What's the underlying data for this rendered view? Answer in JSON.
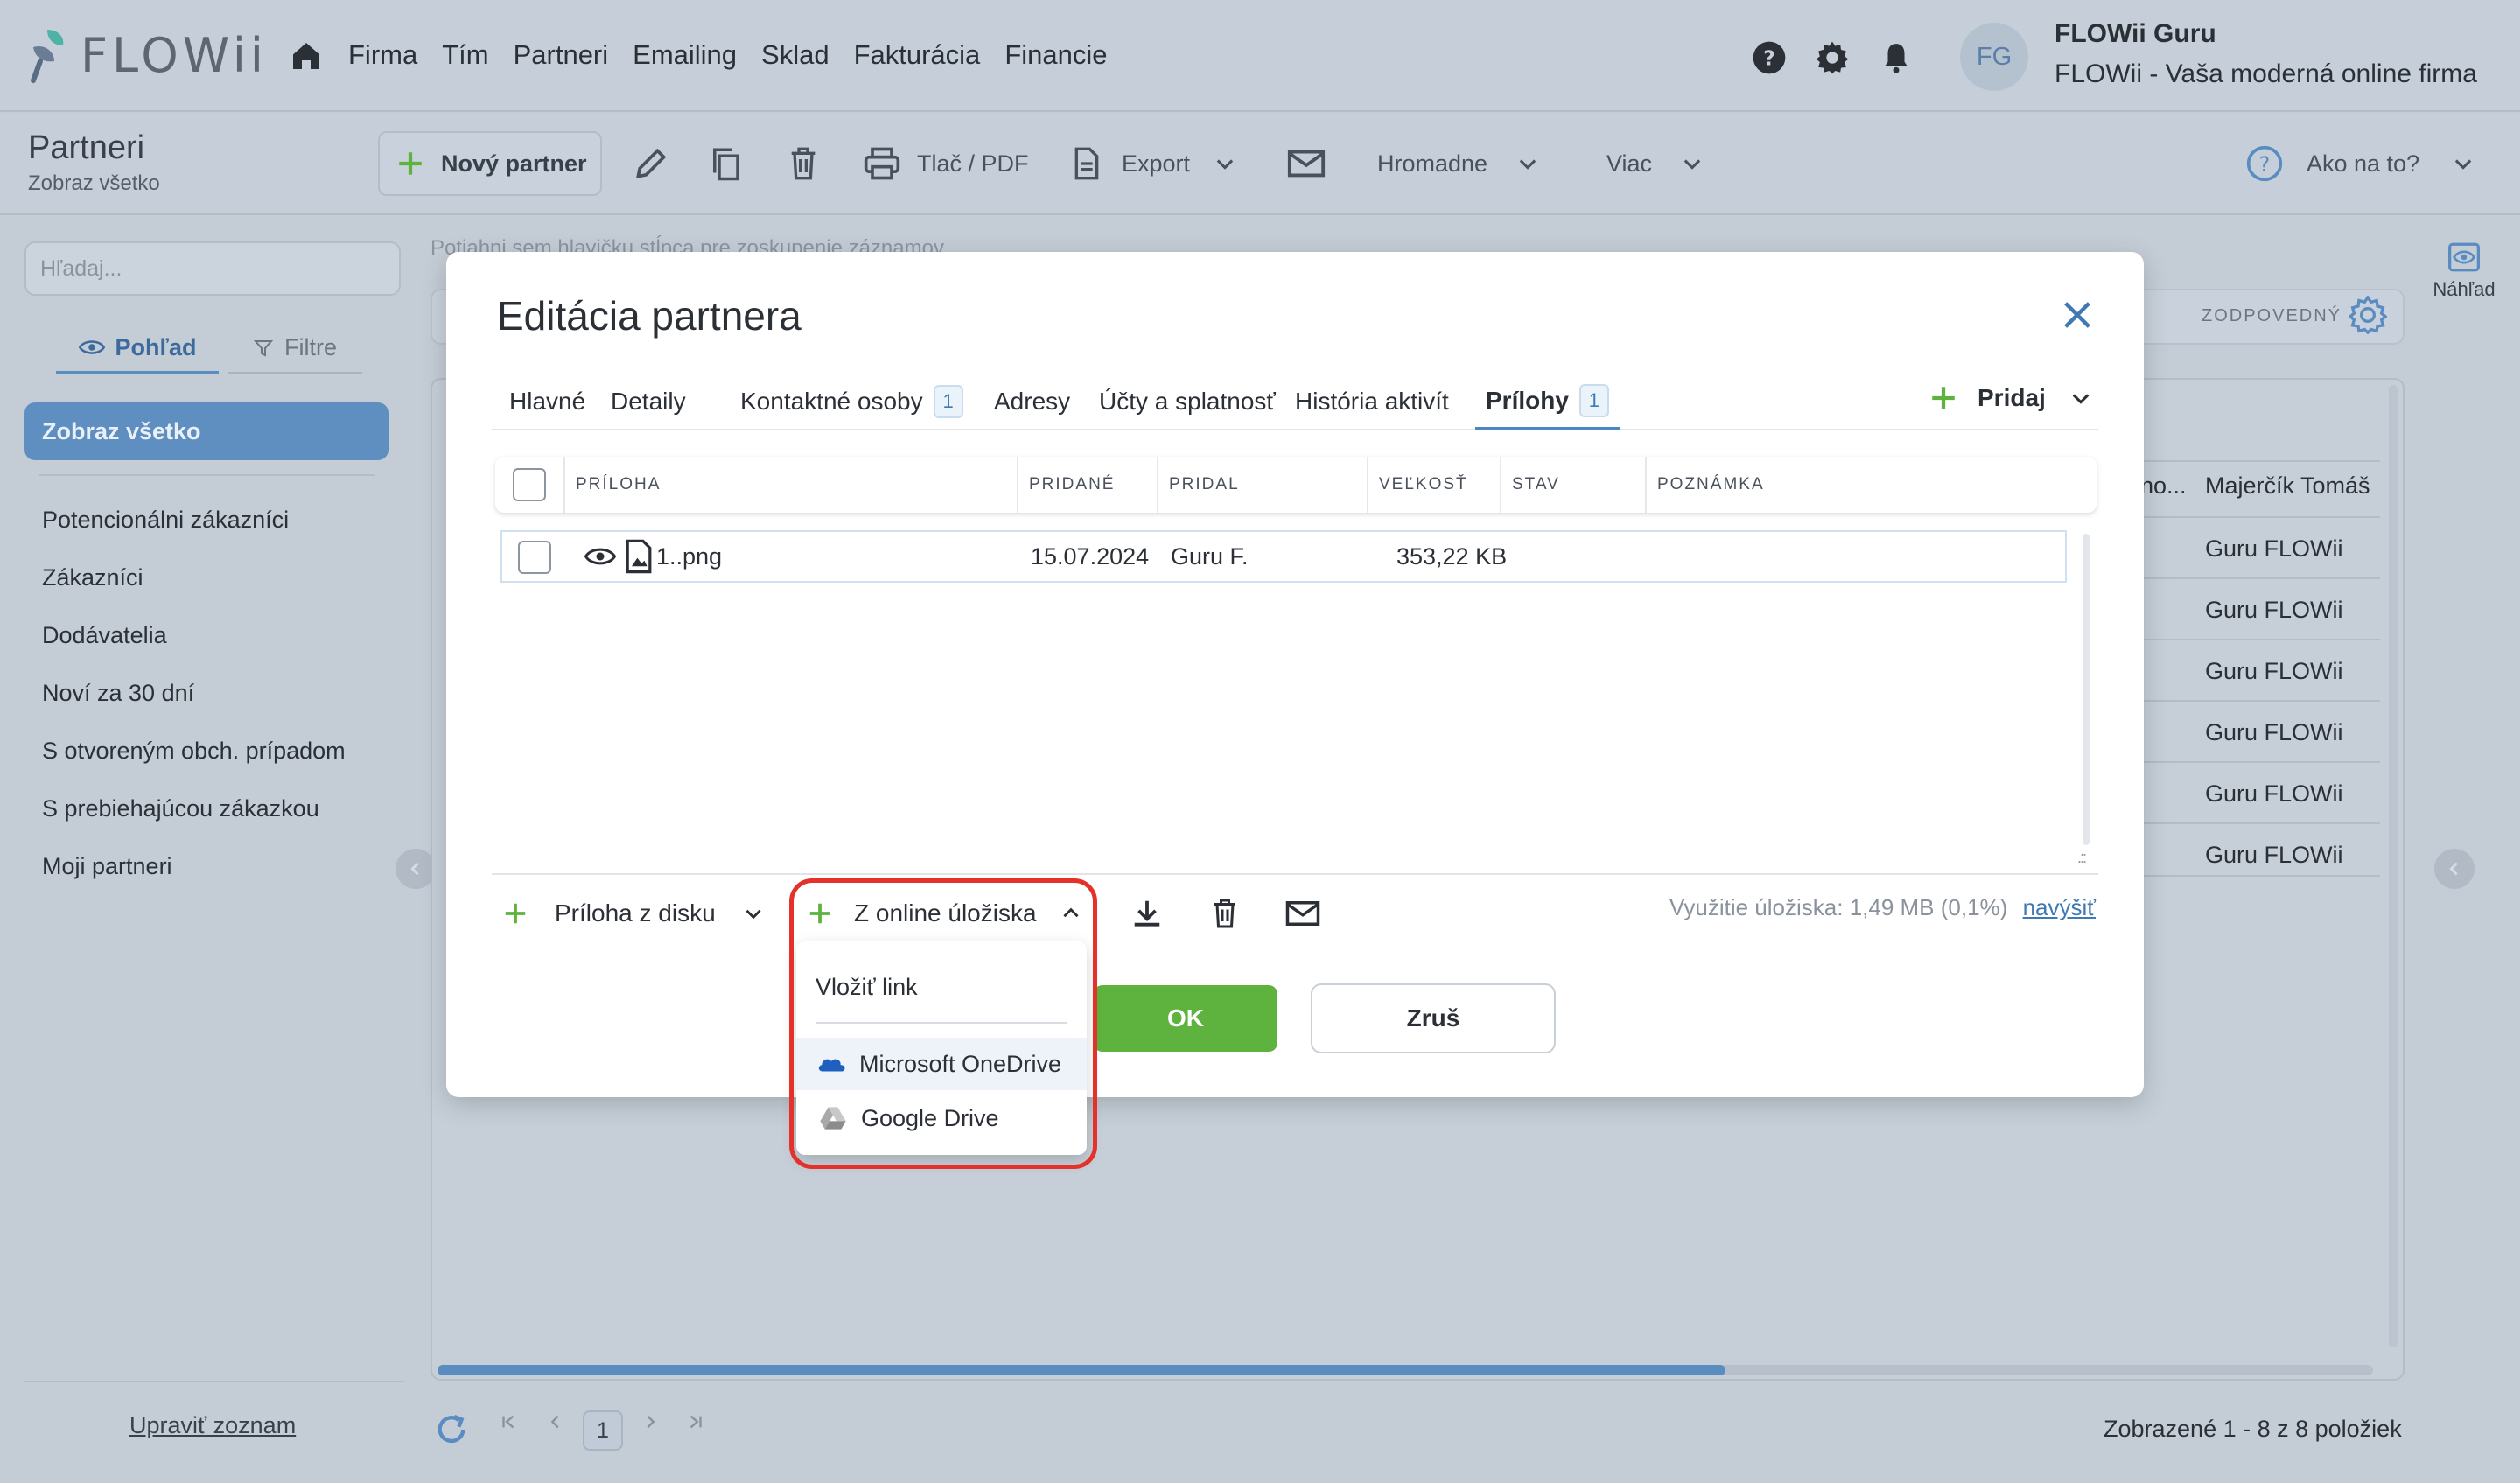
{
  "app": {
    "logo_text": "FLOWii",
    "nav": [
      "Firma",
      "Tím",
      "Partneri",
      "Emailing",
      "Sklad",
      "Fakturácia",
      "Financie"
    ],
    "user": {
      "initials": "FG",
      "name": "FLOWii Guru",
      "company": "FLOWii - Vaša moderná online firma"
    },
    "accent": "#5a8cc2"
  },
  "toolbar": {
    "title": "Partneri",
    "subtitle": "Zobraz všetko",
    "new_partner": "Nový partner",
    "print": "Tlač / PDF",
    "export": "Export",
    "bulk": "Hromadne",
    "more": "Viac",
    "help": "Ako na to?"
  },
  "sidebar": {
    "search_placeholder": "Hľadaj...",
    "tab_view": "Pohľad",
    "tab_filters": "Filtre",
    "active_item": "Zobraz všetko",
    "items": [
      "Potencionálni zákazníci",
      "Zákazníci",
      "Dodávatelia",
      "Noví za 30 dní",
      "S otvoreným obch. prípadom",
      "S prebiehajúcou zákazkou",
      "Moji partneri"
    ],
    "edit_list": "Upraviť zoznam"
  },
  "grid": {
    "group_hint": "Potiahni sem hlavičku stĺpca pre zoskupenie záznamov",
    "responsible_label": "ZODPOVEDNÝ",
    "col_partial": "no...",
    "col_name": "Majerčík Tomáš",
    "cells": [
      "Guru FLOWii",
      "Guru FLOWii",
      "Guru FLOWii",
      "Guru FLOWii",
      "Guru FLOWii",
      "Guru FLOWii"
    ],
    "preview": "Náhľad",
    "page": "1",
    "footer": "Zobrazené 1 - 8 z 8 položiek"
  },
  "modal": {
    "title": "Editácia partnera",
    "tabs": {
      "main": "Hlavné",
      "details": "Detaily",
      "contacts": "Kontaktné osoby",
      "contacts_count": "1",
      "addresses": "Adresy",
      "accounts": "Účty a splatnosť",
      "history": "História aktivít",
      "attachments": "Prílohy",
      "attachments_count": "1"
    },
    "add": "Pridaj",
    "columns": {
      "attachment": "PRÍLOHA",
      "added": "PRIDANÉ",
      "added_by": "PRIDAL",
      "size": "VEĽKOSŤ",
      "status": "STAV",
      "note": "POZNÁMKA"
    },
    "row": {
      "file": "1..png",
      "date": "15.07.2024",
      "by": "Guru F.",
      "size": "353,22 KB"
    },
    "from_disk": "Príloha z disku",
    "from_online": "Z online úložiska",
    "storage_label": "Využitie úložiska:",
    "storage_value": "1,49 MB (0,1%)",
    "storage_link": "navýšiť",
    "ok": "OK",
    "cancel": "Zruš",
    "dropdown": {
      "insert_link": "Vložiť link",
      "onedrive": "Microsoft OneDrive",
      "gdrive": "Google Drive"
    }
  }
}
